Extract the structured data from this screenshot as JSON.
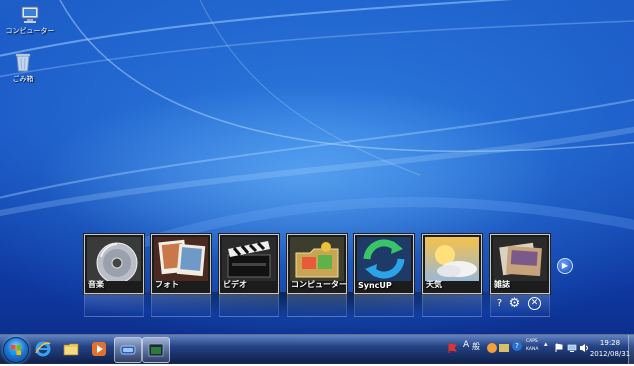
{
  "desktop": {
    "icons": [
      {
        "label": "コンピューター",
        "icon": "computer-icon"
      },
      {
        "label": "ごみ箱",
        "icon": "recycle-bin-icon"
      }
    ],
    "background_color": "#1a55c4"
  },
  "launcher": {
    "tiles": [
      {
        "label": "音楽",
        "icon": "music-cd-icon"
      },
      {
        "label": "フォト",
        "icon": "photo-frames-icon"
      },
      {
        "label": "ビデオ",
        "icon": "clapperboard-icon"
      },
      {
        "label": "コンピューター",
        "icon": "computer-folder-icon"
      },
      {
        "label": "SyncUP",
        "icon": "sync-arrows-icon"
      },
      {
        "label": "天気",
        "icon": "weather-sun-cloud-icon"
      },
      {
        "label": "雑誌",
        "icon": "magazine-icon"
      }
    ],
    "controls": {
      "next": "▶",
      "help": "?",
      "settings": "⚙",
      "close": "✕"
    }
  },
  "taskbar": {
    "pinned": [
      {
        "name": "internet-explorer",
        "icon": "ie-icon"
      },
      {
        "name": "explorer",
        "icon": "folder-icon"
      },
      {
        "name": "media-player",
        "icon": "media-player-icon"
      },
      {
        "name": "launcher-app",
        "icon": "launcher-app-icon",
        "active": true
      },
      {
        "name": "desktop-window",
        "icon": "window-icon",
        "active": true
      }
    ],
    "tray": {
      "ime_mode": "A",
      "ime_label": "般",
      "caps": "CAPS",
      "kana": "KANA",
      "help": "?"
    },
    "clock": {
      "time": "19:28",
      "date": "2012/08/31"
    }
  }
}
